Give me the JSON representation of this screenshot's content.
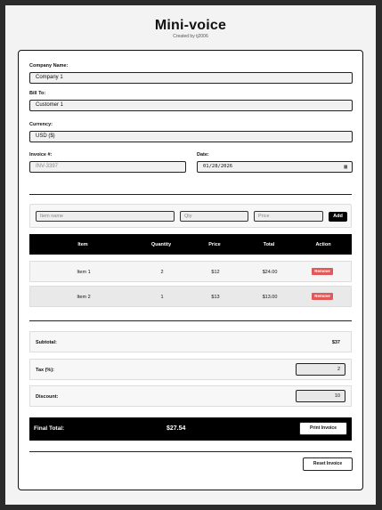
{
  "header": {
    "title": "Mini-voice",
    "subtitle": "Created by tj2006"
  },
  "form": {
    "company_label": "Company Name:",
    "company_value": "Company 1",
    "bill_to_label": "Bill To:",
    "bill_to_value": "Customer 1",
    "currency_label": "Currency:",
    "currency_value": "USD ($)",
    "invoice_label": "Invoice #:",
    "invoice_placeholder": "INV-3397",
    "date_label": "Date:",
    "date_value": "01/28/2026"
  },
  "add_item": {
    "name_placeholder": "Item name",
    "qty_placeholder": "Qty",
    "price_placeholder": "Price",
    "add_label": "Add"
  },
  "table": {
    "columns": [
      "Item",
      "Quantity",
      "Price",
      "Total",
      "Action"
    ],
    "rows": [
      {
        "item": "Item 1",
        "qty": "2",
        "price": "$12",
        "total": "$24.00",
        "action": "Remove"
      },
      {
        "item": "Item 2",
        "qty": "1",
        "price": "$13",
        "total": "$13.00",
        "action": "Remove"
      }
    ]
  },
  "summary": {
    "subtotal_label": "Subtotal:",
    "subtotal_value": "$37",
    "tax_label": "Tax (%):",
    "tax_value": "2",
    "discount_label": "Discount:",
    "discount_value": "10",
    "final_label": "Final Total:",
    "final_value": "$27.54",
    "print_label": "Print Invoice",
    "reset_label": "Reset Invoice"
  },
  "colors": {
    "accent": "#000000",
    "remove": "#e05a5a",
    "page_bg": "#2b2b2b"
  }
}
